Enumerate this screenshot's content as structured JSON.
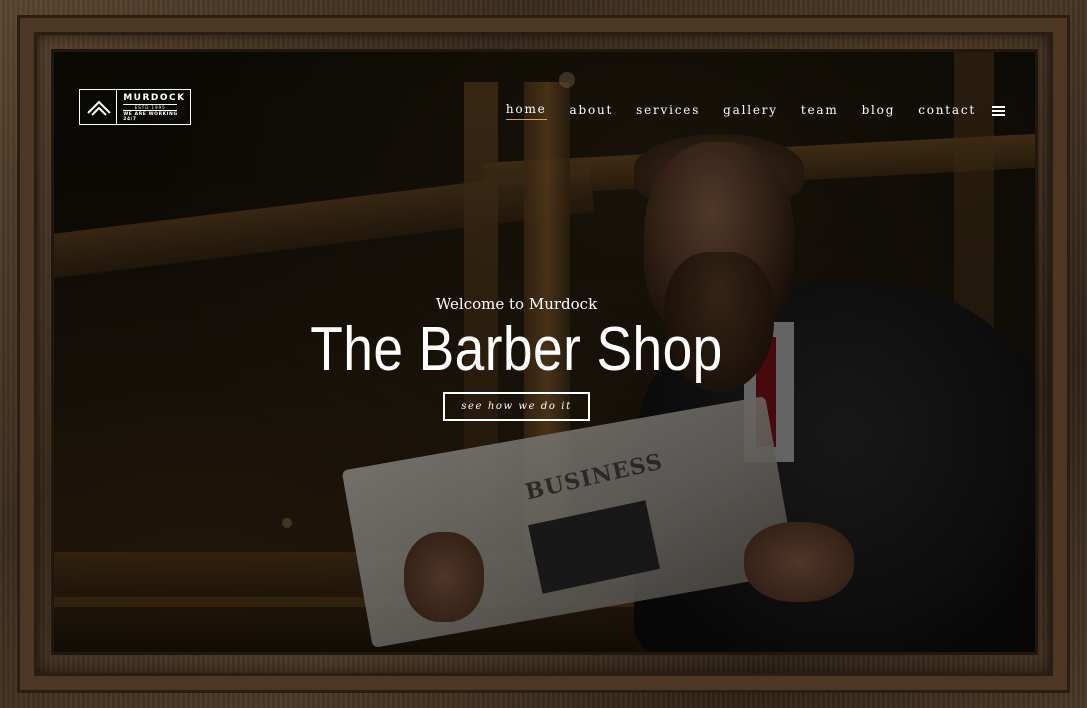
{
  "logo": {
    "name": "MURDOCK",
    "est": "ESTD 1995",
    "tagline": "WE ARE WORKING 24/7"
  },
  "nav": {
    "items": [
      {
        "label": "home",
        "active": true
      },
      {
        "label": "about",
        "active": false
      },
      {
        "label": "services",
        "active": false
      },
      {
        "label": "gallery",
        "active": false
      },
      {
        "label": "team",
        "active": false
      },
      {
        "label": "blog",
        "active": false
      },
      {
        "label": "contact",
        "active": false
      }
    ],
    "menu_icon": "hamburger-menu-icon"
  },
  "hero": {
    "subtitle": "Welcome to Murdock",
    "title": "The Barber Shop",
    "button_label": "see how we do it"
  },
  "photo": {
    "newspaper_headline": "BUSINESS"
  },
  "colors": {
    "accent": "#c9a36a",
    "text": "#ffffff",
    "frame": "#4b3724"
  }
}
